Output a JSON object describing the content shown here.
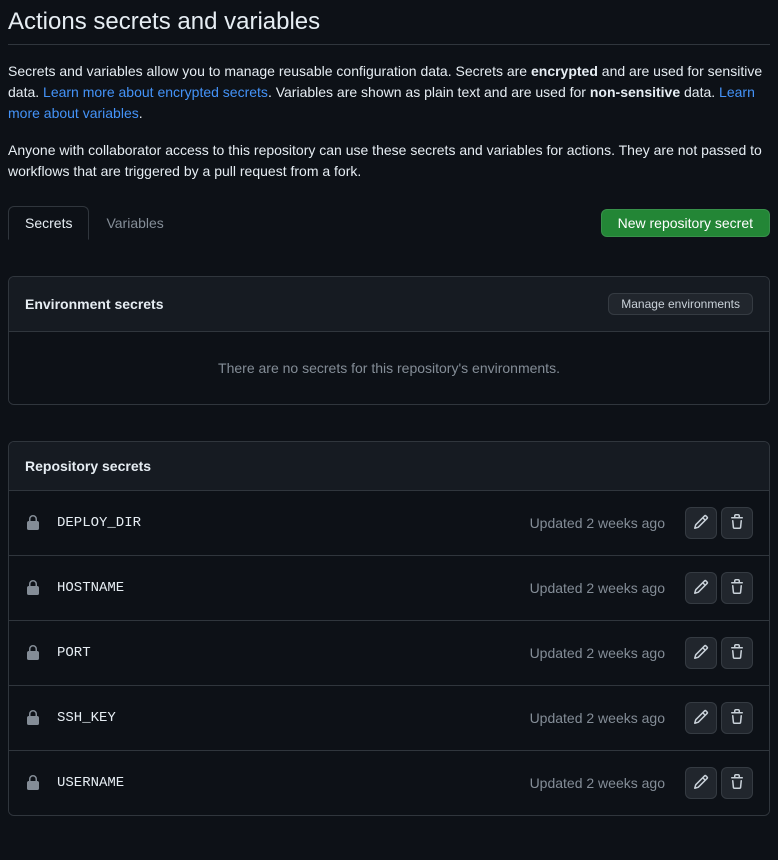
{
  "title": "Actions secrets and variables",
  "description": {
    "p1_t1": "Secrets and variables allow you to manage reusable configuration data. Secrets are ",
    "p1_b1": "encrypted",
    "p1_t2": " and are used for sensitive data. ",
    "p1_link1": "Learn more about encrypted secrets",
    "p1_t3": ". Variables are shown as plain text and are used for ",
    "p1_b2": "non-sensitive",
    "p1_t4": " data. ",
    "p1_link2": "Learn more about variables",
    "p1_t5": ".",
    "p2": "Anyone with collaborator access to this repository can use these secrets and variables for actions. They are not passed to workflows that are triggered by a pull request from a fork."
  },
  "tabs": {
    "secrets": "Secrets",
    "variables": "Variables"
  },
  "buttons": {
    "new_secret": "New repository secret",
    "manage_env": "Manage environments"
  },
  "env_panel": {
    "title": "Environment secrets",
    "empty": "There are no secrets for this repository's environments."
  },
  "repo_panel": {
    "title": "Repository secrets",
    "secrets": [
      {
        "name": "DEPLOY_DIR",
        "updated": "Updated 2 weeks ago"
      },
      {
        "name": "HOSTNAME",
        "updated": "Updated 2 weeks ago"
      },
      {
        "name": "PORT",
        "updated": "Updated 2 weeks ago"
      },
      {
        "name": "SSH_KEY",
        "updated": "Updated 2 weeks ago"
      },
      {
        "name": "USERNAME",
        "updated": "Updated 2 weeks ago"
      }
    ]
  }
}
